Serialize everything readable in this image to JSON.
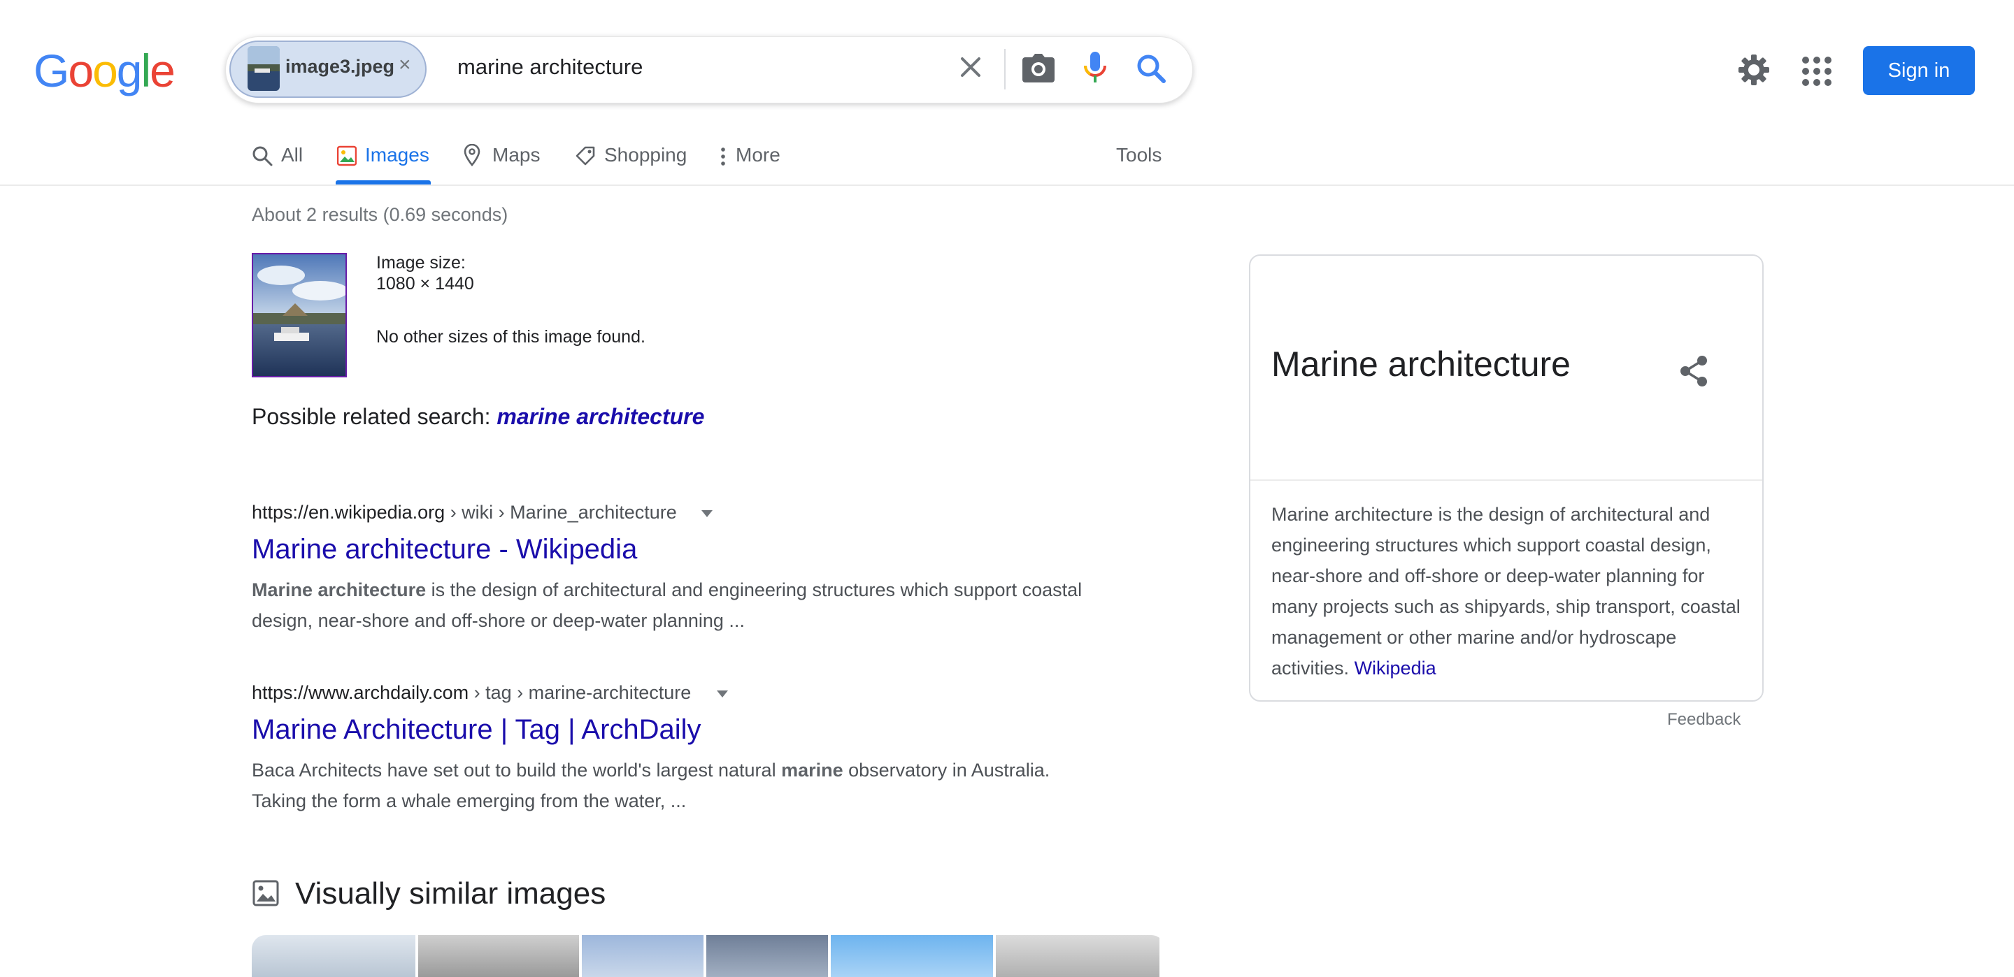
{
  "logo": {
    "letters": [
      "G",
      "o",
      "o",
      "g",
      "l",
      "e"
    ]
  },
  "search": {
    "image_chip_label": "image3.jpeg",
    "chip_remove": "×",
    "query": "marine architecture"
  },
  "header": {
    "sign_in": "Sign in"
  },
  "tabs": [
    {
      "label": "All",
      "icon": "search-icon",
      "active": false
    },
    {
      "label": "Images",
      "icon": "image-icon",
      "active": true
    },
    {
      "label": "Maps",
      "icon": "map-pin-icon",
      "active": false
    },
    {
      "label": "Shopping",
      "icon": "tag-icon",
      "active": false
    },
    {
      "label": "More",
      "icon": "more-vert-icon",
      "active": false
    }
  ],
  "tools_label": "Tools",
  "result_stats": "About 2 results (0.69 seconds)",
  "image_info": {
    "size_label": "Image size:",
    "size_value": "1080 × 1440",
    "no_other_sizes": "No other sizes of this image found."
  },
  "related_search": {
    "prefix": "Possible related search:",
    "term": "marine architecture"
  },
  "results": [
    {
      "domain": "https://en.wikipedia.org",
      "crumbs": "› wiki › Marine_architecture",
      "title": "Marine architecture - Wikipedia",
      "snippet_bold": "Marine architecture",
      "snippet_rest": " is the design of architectural and engineering structures which support coastal design, near-shore and off-shore or deep-water planning ..."
    },
    {
      "domain": "https://www.archdaily.com",
      "crumbs": "› tag › marine-architecture",
      "title": "Marine Architecture | Tag | ArchDaily",
      "snippet_pre": "Baca Architects have set out to build the world's largest natural ",
      "snippet_bold": "marine",
      "snippet_rest": " observatory in Australia. Taking the form a whale emerging from the water, ..."
    }
  ],
  "visually_similar": {
    "title": "Visually similar images"
  },
  "knowledge_panel": {
    "title": "Marine architecture",
    "description": "Marine architecture is the design of architectural and engineering structures which support coastal design, near-shore and off-shore or deep-water planning for many projects such as shipyards, ship transport, coastal management or other marine and/or hydroscape activities.",
    "source_link": "Wikipedia",
    "feedback": "Feedback"
  },
  "colors": {
    "accent": "#1a73e8",
    "link": "#1a0dab",
    "google_blue": "#4285f4",
    "google_red": "#ea4335",
    "google_yellow": "#fbbc05",
    "google_green": "#34a853"
  }
}
